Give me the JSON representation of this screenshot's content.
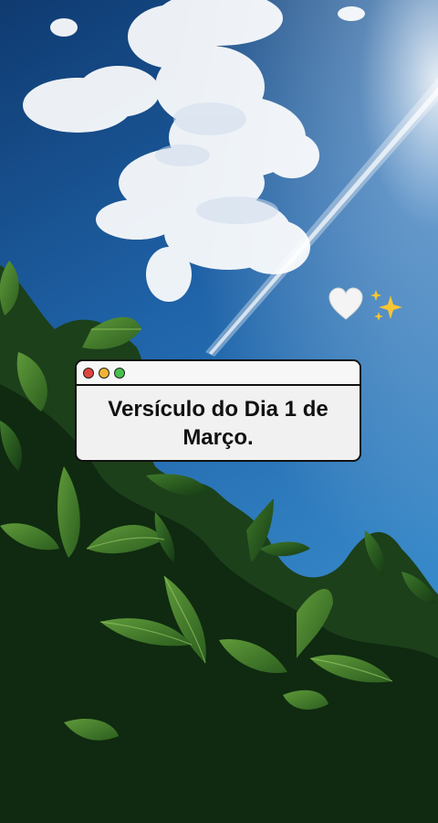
{
  "card": {
    "text": "Versículo do Dia 1 de Março.",
    "controls": {
      "close_color": "#e0443e",
      "minimize_color": "#f2b233",
      "maximize_color": "#45c04a"
    }
  },
  "decorations": {
    "heart": "white-heart-icon",
    "sparkles": "sparkles-icon"
  },
  "colors": {
    "sky_top": "#123f78",
    "sky_bottom": "#2d7fc0",
    "foliage": "#1e4d1f"
  }
}
